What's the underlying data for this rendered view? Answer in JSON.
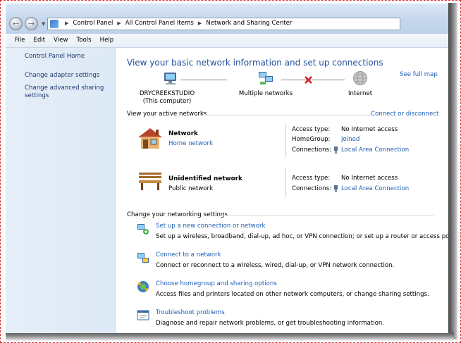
{
  "address_bar": {
    "crumbs": [
      "Control Panel",
      "All Control Panel Items",
      "Network and Sharing Center"
    ]
  },
  "menu": [
    "File",
    "Edit",
    "View",
    "Tools",
    "Help"
  ],
  "sidebar": {
    "items": [
      {
        "label": "Control Panel Home"
      },
      {
        "label": "Change adapter settings"
      },
      {
        "label": "Change advanced sharing settings"
      }
    ]
  },
  "main": {
    "title": "View your basic network information and set up connections",
    "see_full_map": "See full map",
    "map": {
      "computer_name": "DRYCREEKSTUDIO",
      "computer_sub": "(This computer)",
      "middle": "Multiple networks",
      "internet": "Internet"
    },
    "active_networks": {
      "header": "View your active networks",
      "connect_link": "Connect or disconnect",
      "networks": [
        {
          "name": "Network",
          "type": "Home network",
          "rows": [
            {
              "label": "Access type:",
              "value": "No Internet access"
            },
            {
              "label": "HomeGroup:",
              "value": "Joined"
            },
            {
              "label": "Connections:",
              "value": "Local Area Connection"
            }
          ]
        },
        {
          "name": "Unidentified network",
          "type": "Public network",
          "rows": [
            {
              "label": "Access type:",
              "value": "No Internet access"
            },
            {
              "label": "Connections:",
              "value": "Local Area Connection"
            }
          ]
        }
      ]
    },
    "settings": {
      "header": "Change your networking settings",
      "tasks": [
        {
          "title": "Set up a new connection or network",
          "desc": "Set up a wireless, broadband, dial-up, ad hoc, or VPN connection; or set up a router or access point."
        },
        {
          "title": "Connect to a network",
          "desc": "Connect or reconnect to a wireless, wired, dial-up, or VPN network connection."
        },
        {
          "title": "Choose homegroup and sharing options",
          "desc": "Access files and printers located on other network computers, or change sharing settings."
        },
        {
          "title": "Troubleshoot problems",
          "desc": "Diagnose and repair network problems, or get troubleshooting information."
        }
      ]
    }
  },
  "colors": {
    "link": "#1d5fb5",
    "title": "#1f4e9a",
    "sidebar_bg": "#dde9f6",
    "error_x": "#d9201e"
  }
}
